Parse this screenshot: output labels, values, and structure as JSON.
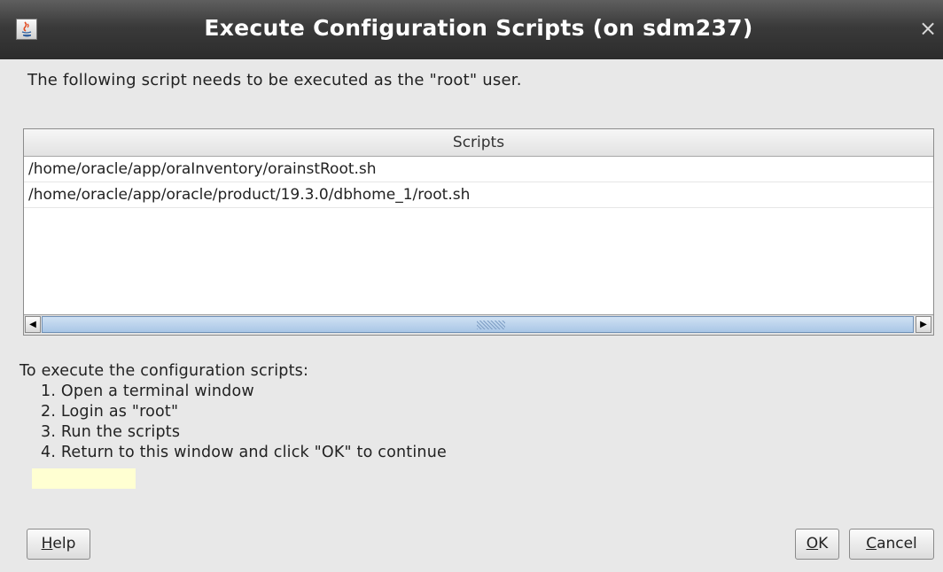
{
  "window": {
    "title": "Execute Configuration Scripts (on sdm237)",
    "app_icon": "java-icon",
    "close_glyph": "×"
  },
  "intro_text": "The following script needs to be executed as the \"root\" user.",
  "scripts_table": {
    "header": "Scripts",
    "rows": [
      "/home/oracle/app/oraInventory/orainstRoot.sh",
      "/home/oracle/app/oracle/product/19.3.0/dbhome_1/root.sh"
    ],
    "scroll_left_glyph": "◀",
    "scroll_right_glyph": "▶"
  },
  "instructions": {
    "heading": "To execute the configuration scripts:",
    "steps": [
      "1. Open a terminal window",
      "2. Login as \"root\"",
      "3. Run the scripts",
      "4. Return to this window and click \"OK\" to continue"
    ]
  },
  "buttons": {
    "help": {
      "mnemonic": "H",
      "rest": "elp"
    },
    "ok": {
      "mnemonic": "O",
      "rest": "K"
    },
    "cancel": {
      "mnemonic": "C",
      "rest": "ancel"
    }
  },
  "colors": {
    "titlebar": "#3a3a3a",
    "dialog_bg": "#e8e8e8",
    "scroll_thumb": "#a9c6e6",
    "note_highlight": "#ffffd2"
  }
}
